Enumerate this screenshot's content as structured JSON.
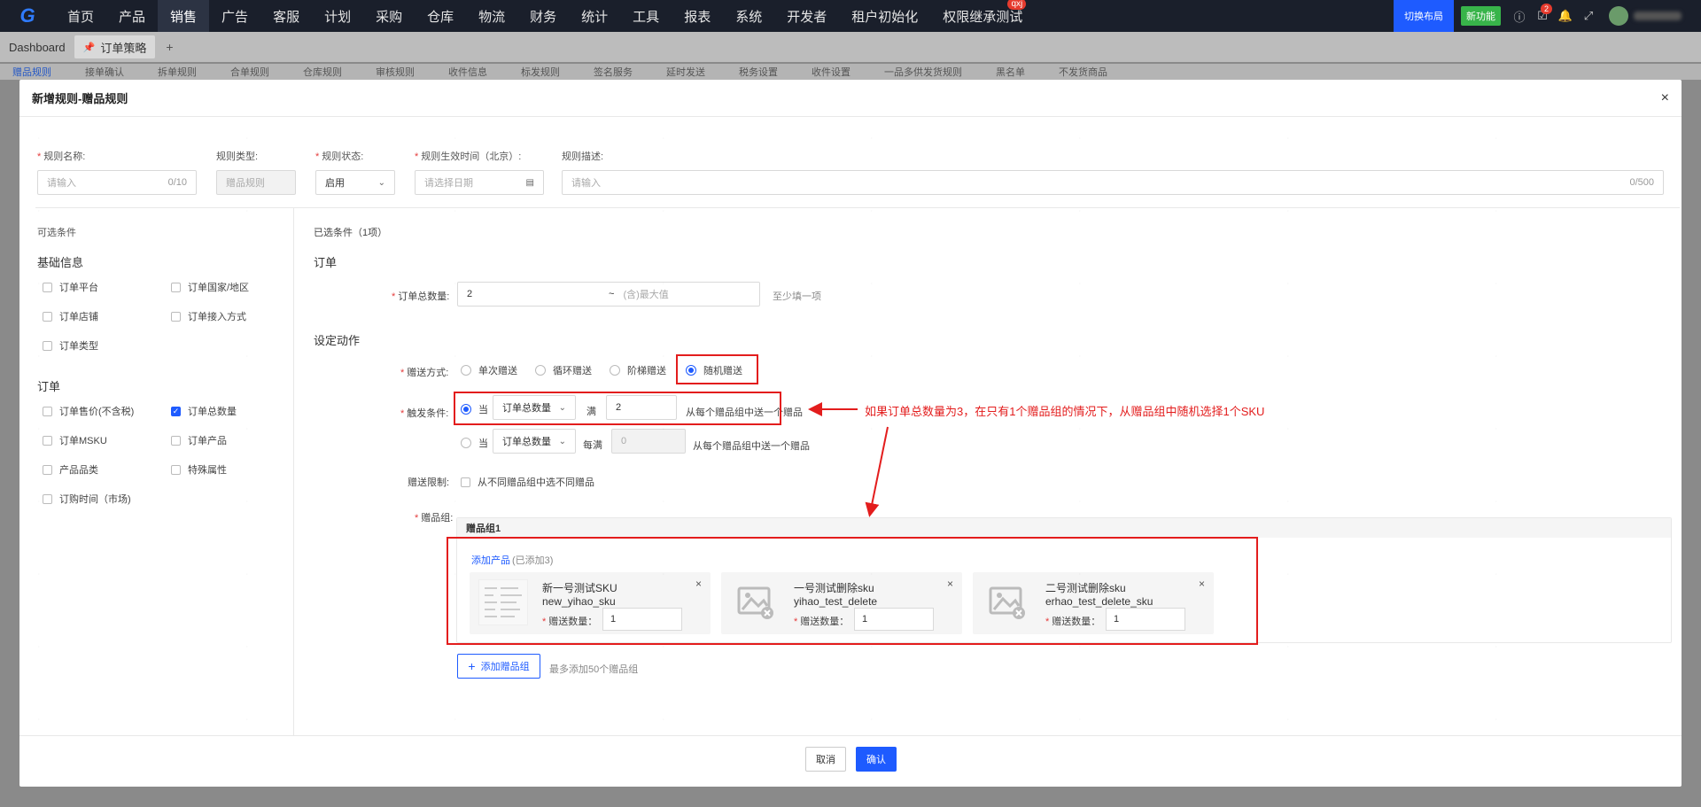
{
  "nav": {
    "logo": "G",
    "items": [
      {
        "label": "首页"
      },
      {
        "label": "产品"
      },
      {
        "label": "销售",
        "active": true
      },
      {
        "label": "广告"
      },
      {
        "label": "客服"
      },
      {
        "label": "计划"
      },
      {
        "label": "采购"
      },
      {
        "label": "仓库"
      },
      {
        "label": "物流"
      },
      {
        "label": "财务"
      },
      {
        "label": "统计"
      },
      {
        "label": "工具"
      },
      {
        "label": "报表"
      },
      {
        "label": "系统"
      },
      {
        "label": "开发者"
      },
      {
        "label": "租户初始化"
      },
      {
        "label": "权限继承测试",
        "badge": "qxj"
      }
    ],
    "switch_layout": "切换布局",
    "new_feature": "新功能",
    "todo_count": "2"
  },
  "tabs": {
    "dashboard": "Dashboard",
    "current": "订单策略",
    "add": "+"
  },
  "subtabs": [
    "赠品规则",
    "接单确认",
    "拆单规则",
    "合单规则",
    "仓库规则",
    "审核规则",
    "收件信息",
    "标发规则",
    "签名服务",
    "延时发送",
    "税务设置",
    "收件设置",
    "一品多供发货规则",
    "黑名单",
    "不发货商品"
  ],
  "modal": {
    "title": "新增规则-赠品规则",
    "close": "×",
    "fields": {
      "rule_name_label": "规则名称:",
      "rule_name_placeholder": "请输入",
      "rule_name_counter": "0/10",
      "rule_type_label": "规则类型:",
      "rule_type_value": "赠品规则",
      "rule_status_label": "规则状态:",
      "rule_status_value": "启用",
      "effective_label": "规则生效时间（北京）:",
      "effective_placeholder": "请选择日期",
      "desc_label": "规则描述:",
      "desc_placeholder": "请输入",
      "desc_counter": "0/500"
    },
    "left": {
      "title": "可选条件",
      "basic_title": "基础信息",
      "basic_items": [
        {
          "label": "订单平台",
          "checked": false
        },
        {
          "label": "订单国家/地区",
          "checked": false
        },
        {
          "label": "订单店铺",
          "checked": false
        },
        {
          "label": "订单接入方式",
          "checked": false
        },
        {
          "label": "订单类型",
          "checked": false
        }
      ],
      "order_title": "订单",
      "order_items": [
        {
          "label": "订单售价(不含税)",
          "checked": false
        },
        {
          "label": "订单总数量",
          "checked": true
        },
        {
          "label": "订单MSKU",
          "checked": false
        },
        {
          "label": "订单产品",
          "checked": false
        },
        {
          "label": "产品品类",
          "checked": false
        },
        {
          "label": "特殊属性",
          "checked": false
        },
        {
          "label": "订购时间（市场)",
          "checked": false
        }
      ]
    },
    "right": {
      "selected_title": "已选条件（1项）",
      "order_section": "订单",
      "total_qty_label": "订单总数量:",
      "total_qty_value": "2",
      "range_sep": "~",
      "max_placeholder": "(含)最大值",
      "hint_fill": "至少填一项",
      "action_section": "设定动作",
      "gift_mode_label": "赠送方式:",
      "gift_modes": [
        {
          "label": "单次赠送",
          "selected": false
        },
        {
          "label": "循环赠送",
          "selected": false
        },
        {
          "label": "阶梯赠送",
          "selected": false
        },
        {
          "label": "随机赠送",
          "selected": true
        }
      ],
      "trigger_label": "触发条件:",
      "trigger1": {
        "when": "当",
        "field": "订单总数量",
        "op": "满",
        "value": "2",
        "suffix": "从每个赠品组中送一个赠品"
      },
      "trigger2": {
        "when": "当",
        "field": "订单总数量",
        "op": "每满",
        "value": "0",
        "suffix": "从每个赠品组中送一个赠品"
      },
      "limit_label": "赠送限制:",
      "limit_option": "从不同赠品组中选不同赠品",
      "gift_group_label": "赠品组:",
      "group_name": "赠品组1",
      "add_product": "添加产品",
      "added_count": "(已添加3)",
      "products": [
        {
          "name": "新一号测试SKU",
          "sku": "new_yihao_sku",
          "qty_label": "赠送数量：",
          "qty": "1",
          "thumb": "screenshot"
        },
        {
          "name": "一号测试删除sku",
          "sku": "yihao_test_delete",
          "qty_label": "赠送数量：",
          "qty": "1",
          "thumb": "image-placeholder"
        },
        {
          "name": "二号测试删除sku",
          "sku": "erhao_test_delete_sku",
          "qty_label": "赠送数量：",
          "qty": "1",
          "thumb": "image-placeholder"
        }
      ],
      "add_group_btn": "添加赠品组",
      "add_group_hint": "最多添加50个赠品组"
    },
    "annotation": "如果订单总数量为3，在只有1个赠品组的情况下，从赠品组中随机选择1个SKU",
    "footer": {
      "cancel": "取消",
      "confirm": "确认"
    }
  },
  "colors": {
    "primary": "#1e5bff",
    "annotation": "#e31d1d",
    "nav_bg": "#1a1f2b",
    "new_feature": "#38b44a"
  }
}
